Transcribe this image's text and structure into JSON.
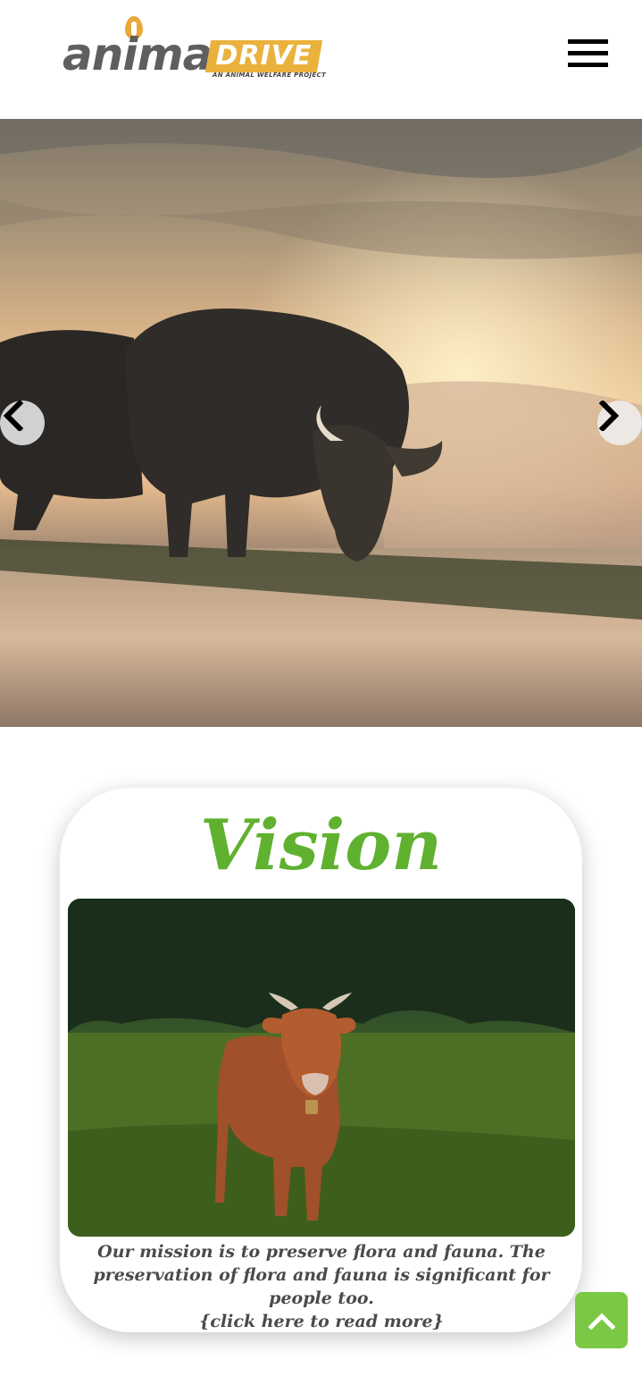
{
  "header": {
    "logo": {
      "word_primary": "anima",
      "word_secondary": "DRIVE",
      "tagline": "AN ANIMAL WELFARE PROJECT"
    },
    "menu_icon": "hamburger-menu-icon"
  },
  "hero": {
    "prev_icon": "chevron-left-icon",
    "next_icon": "chevron-right-icon"
  },
  "vision": {
    "title": "Vision",
    "caption": "Our mission is to preserve flora and fauna. The preservation of flora and fauna is significant for people too.",
    "read_more": "{click here to read more}"
  },
  "scroll_top_icon": "chevron-up-icon",
  "colors": {
    "brand_gray": "#5f5f5f",
    "brand_yellow": "#eab23d",
    "accent_green": "#5fb12f",
    "button_green": "#7ac843"
  }
}
